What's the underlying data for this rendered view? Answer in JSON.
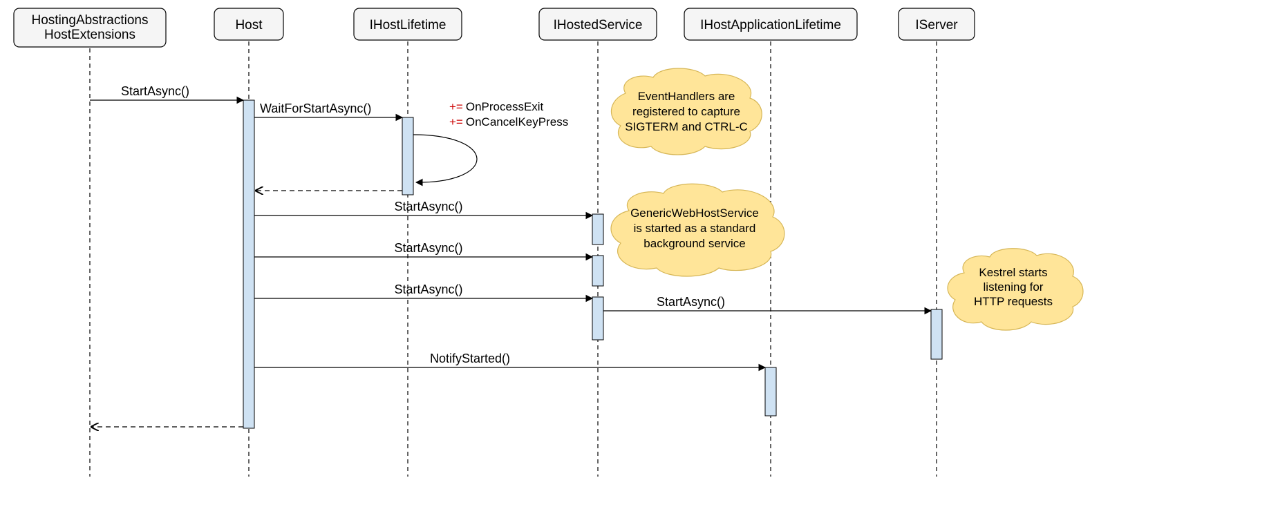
{
  "participants": {
    "p0_line1": "HostingAbstractions",
    "p0_line2": "HostExtensions",
    "p1": "Host",
    "p2": "IHostLifetime",
    "p3": "IHostedService",
    "p4": "IHostApplicationLifetime",
    "p5": "IServer"
  },
  "messages": {
    "m0": "StartAsync()",
    "m1": "WaitForStartAsync()",
    "m2": "StartAsync()",
    "m3": "StartAsync()",
    "m4": "StartAsync()",
    "m5": "StartAsync()",
    "m6": "NotifyStarted()"
  },
  "events": {
    "e0": "OnProcessExit",
    "e1": "OnCancelKeyPress",
    "prefix": "+="
  },
  "notes": {
    "n0_l1": "EventHandlers are",
    "n0_l2": "registered to capture",
    "n0_l3": "SIGTERM and CTRL-C",
    "n1_l1": "GenericWebHostService",
    "n1_l2": "is started as a standard",
    "n1_l3": "background service",
    "n2_l1": "Kestrel starts",
    "n2_l2": "listening for",
    "n2_l3": "HTTP requests"
  }
}
